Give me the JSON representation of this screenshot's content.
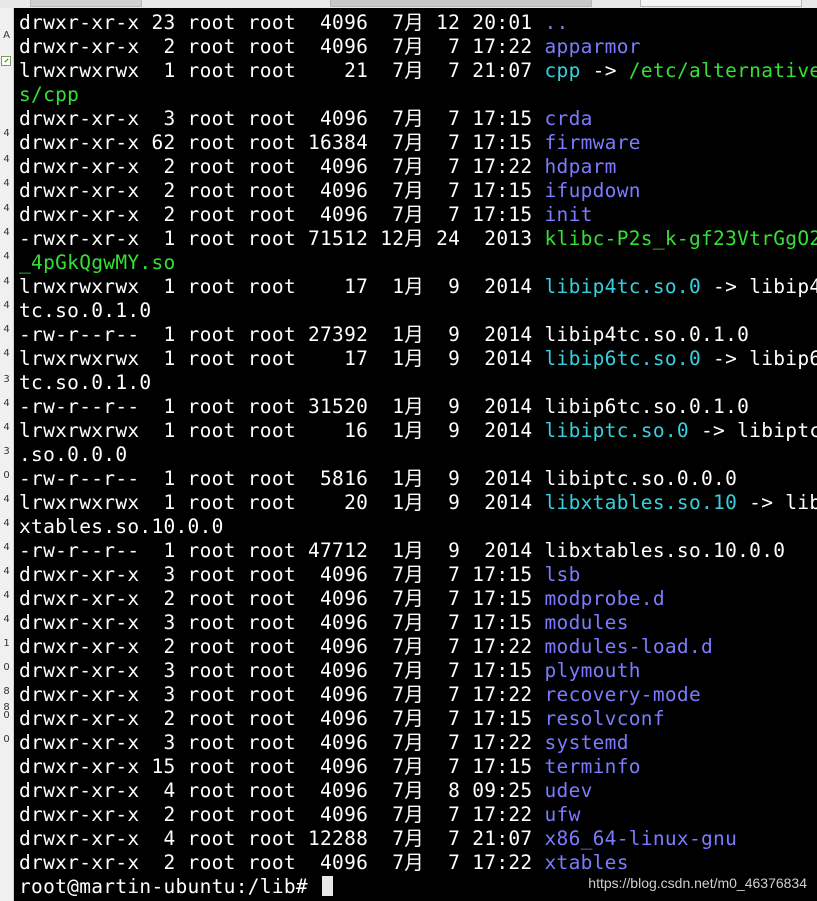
{
  "gutter": {
    "chars": [
      "A",
      "4",
      "4",
      "4",
      "4",
      "4",
      "4",
      "4",
      "4",
      "4",
      "4",
      "4",
      "3",
      "4",
      "4",
      "3",
      "0",
      "4",
      "4",
      "4",
      "4",
      "4",
      "4",
      "1",
      "0",
      "8",
      "0",
      "0",
      "8"
    ]
  },
  "terminal": {
    "lines": [
      {
        "pre": "drwxr-xr-x 23 root root  4096  7月 12 20:01 ",
        "name": "..",
        "type": "dir"
      },
      {
        "pre": "drwxr-xr-x  2 root root  4096  7月  7 17:22 ",
        "name": "apparmor",
        "type": "dir"
      },
      {
        "pre": "lrwxrwxrwx  1 root root    21  7月  7 21:07 ",
        "name": "cpp",
        "type": "link",
        "arrow": " -> ",
        "target": "/etc/alternative",
        "targetClass": "exec"
      },
      {
        "pre": "",
        "name": "s/cpp",
        "type": "exec"
      },
      {
        "pre": "drwxr-xr-x  3 root root  4096  7月  7 17:15 ",
        "name": "crda",
        "type": "dir"
      },
      {
        "pre": "drwxr-xr-x 62 root root 16384  7月  7 17:15 ",
        "name": "firmware",
        "type": "dir"
      },
      {
        "pre": "drwxr-xr-x  2 root root  4096  7月  7 17:22 ",
        "name": "hdparm",
        "type": "dir"
      },
      {
        "pre": "drwxr-xr-x  2 root root  4096  7月  7 17:15 ",
        "name": "ifupdown",
        "type": "dir"
      },
      {
        "pre": "drwxr-xr-x  2 root root  4096  7月  7 17:15 ",
        "name": "init",
        "type": "dir"
      },
      {
        "pre": "-rwxr-xr-x  1 root root 71512 12月 24  2013 ",
        "name": "klibc-P2s_k-gf23VtrGgO2",
        "type": "exec"
      },
      {
        "pre": "",
        "name": "_4pGkQgwMY.so",
        "type": "exec"
      },
      {
        "pre": "lrwxrwxrwx  1 root root    17  1月  9  2014 ",
        "name": "libip4tc.so.0",
        "type": "link",
        "arrow": " -> ",
        "target": "libip4",
        "targetClass": "target"
      },
      {
        "pre": "tc.so.0.1.0",
        "name": "",
        "type": "plain"
      },
      {
        "pre": "-rw-r--r--  1 root root 27392  1月  9  2014 ",
        "name": "libip4tc.so.0.1.0",
        "type": "plain"
      },
      {
        "pre": "lrwxrwxrwx  1 root root    17  1月  9  2014 ",
        "name": "libip6tc.so.0",
        "type": "link",
        "arrow": " -> ",
        "target": "libip6",
        "targetClass": "target"
      },
      {
        "pre": "tc.so.0.1.0",
        "name": "",
        "type": "plain"
      },
      {
        "pre": "-rw-r--r--  1 root root 31520  1月  9  2014 ",
        "name": "libip6tc.so.0.1.0",
        "type": "plain"
      },
      {
        "pre": "lrwxrwxrwx  1 root root    16  1月  9  2014 ",
        "name": "libiptc.so.0",
        "type": "link",
        "arrow": " -> ",
        "target": "libiptc",
        "targetClass": "target"
      },
      {
        "pre": ".so.0.0.0",
        "name": "",
        "type": "plain"
      },
      {
        "pre": "-rw-r--r--  1 root root  5816  1月  9  2014 ",
        "name": "libiptc.so.0.0.0",
        "type": "plain"
      },
      {
        "pre": "lrwxrwxrwx  1 root root    20  1月  9  2014 ",
        "name": "libxtables.so.10",
        "type": "link",
        "arrow": " -> ",
        "target": "lib",
        "targetClass": "target"
      },
      {
        "pre": "xtables.so.10.0.0",
        "name": "",
        "type": "plain"
      },
      {
        "pre": "-rw-r--r--  1 root root 47712  1月  9  2014 ",
        "name": "libxtables.so.10.0.0",
        "type": "plain"
      },
      {
        "pre": "drwxr-xr-x  3 root root  4096  7月  7 17:15 ",
        "name": "lsb",
        "type": "dir"
      },
      {
        "pre": "drwxr-xr-x  2 root root  4096  7月  7 17:15 ",
        "name": "modprobe.d",
        "type": "dir"
      },
      {
        "pre": "drwxr-xr-x  3 root root  4096  7月  7 17:15 ",
        "name": "modules",
        "type": "dir"
      },
      {
        "pre": "drwxr-xr-x  2 root root  4096  7月  7 17:22 ",
        "name": "modules-load.d",
        "type": "dir"
      },
      {
        "pre": "drwxr-xr-x  3 root root  4096  7月  7 17:15 ",
        "name": "plymouth",
        "type": "dir"
      },
      {
        "pre": "drwxr-xr-x  3 root root  4096  7月  7 17:22 ",
        "name": "recovery-mode",
        "type": "dir"
      },
      {
        "pre": "drwxr-xr-x  2 root root  4096  7月  7 17:15 ",
        "name": "resolvconf",
        "type": "dir"
      },
      {
        "pre": "drwxr-xr-x  3 root root  4096  7月  7 17:22 ",
        "name": "systemd",
        "type": "dir"
      },
      {
        "pre": "drwxr-xr-x 15 root root  4096  7月  7 17:15 ",
        "name": "terminfo",
        "type": "dir"
      },
      {
        "pre": "drwxr-xr-x  4 root root  4096  7月  8 09:25 ",
        "name": "udev",
        "type": "dir"
      },
      {
        "pre": "drwxr-xr-x  2 root root  4096  7月  7 17:22 ",
        "name": "ufw",
        "type": "dir"
      },
      {
        "pre": "drwxr-xr-x  4 root root 12288  7月  7 21:07 ",
        "name": "x86_64-linux-gnu",
        "type": "dir"
      },
      {
        "pre": "drwxr-xr-x  2 root root  4096  7月  7 17:22 ",
        "name": "xtables",
        "type": "dir"
      }
    ],
    "prompt": "root@martin-ubuntu:/lib# ",
    "watermark": "https://blog.csdn.net/m0_46376834"
  },
  "colors": {
    "background": "#000000",
    "text": "#ffffff",
    "directory": "#7b7bff",
    "symlink": "#36d0e0",
    "executable": "#35e035"
  }
}
